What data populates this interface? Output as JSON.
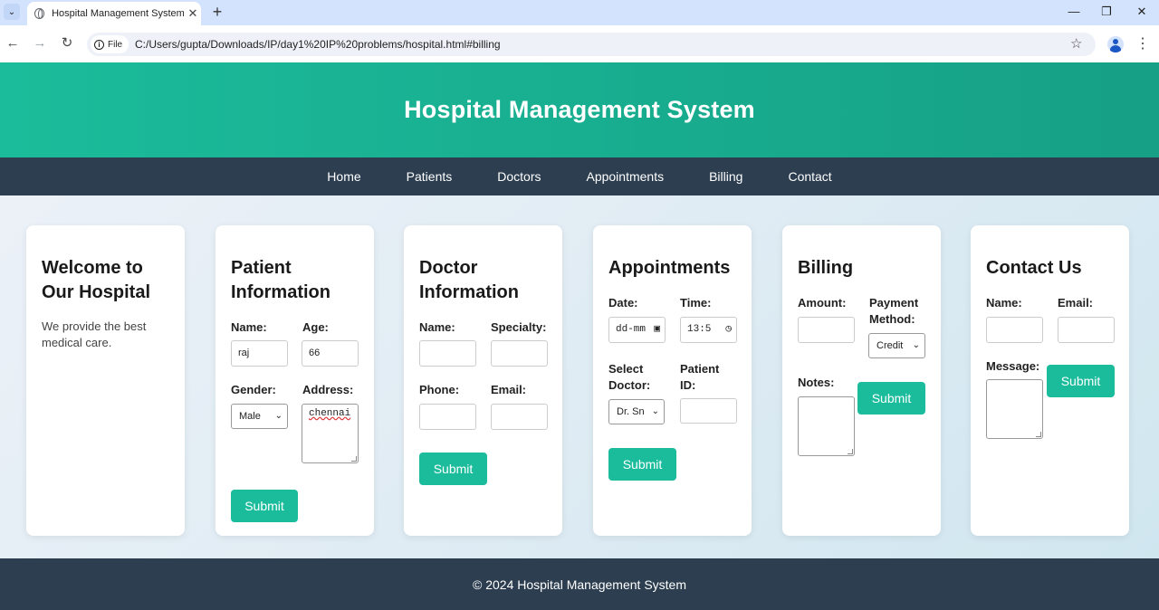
{
  "browser": {
    "tab_menu_icon": "chevron-down-icon",
    "tab_title": "Hospital Management System",
    "tab_close": "✕",
    "new_tab": "+",
    "minimize": "—",
    "restore": "❐",
    "close": "✕",
    "back": "←",
    "forward": "→",
    "reload": "↻",
    "chip_label": "File",
    "url": "C:/Users/gupta/Downloads/IP/day1%20IP%20problems/hospital.html#billing",
    "star": "☆",
    "menu": "⋮"
  },
  "header": {
    "title": "Hospital Management System"
  },
  "nav": {
    "items": [
      "Home",
      "Patients",
      "Doctors",
      "Appointments",
      "Billing",
      "Contact"
    ]
  },
  "welcome": {
    "title": "Welcome to Our Hospital",
    "text": "We provide the best medical care."
  },
  "patient": {
    "title": "Patient Information",
    "name_label": "Name:",
    "name_value": "raj",
    "age_label": "Age:",
    "age_value": "66",
    "gender_label": "Gender:",
    "gender_value": "Male",
    "address_label": "Address:",
    "address_value": "chennai",
    "submit": "Submit"
  },
  "doctor": {
    "title": "Doctor Information",
    "name_label": "Name:",
    "specialty_label": "Specialty:",
    "phone_label": "Phone:",
    "email_label": "Email:",
    "submit": "Submit"
  },
  "appointments": {
    "title": "Appointments",
    "date_label": "Date:",
    "date_value": "dd-mm",
    "time_label": "Time:",
    "time_value": "13:5",
    "doctor_label": "Select Doctor:",
    "doctor_value": "Dr. Sn",
    "patient_label": "Patient ID:",
    "submit": "Submit"
  },
  "billing": {
    "title": "Billing",
    "amount_label": "Amount:",
    "payment_label": "Payment Method:",
    "payment_value": "Credit",
    "notes_label": "Notes:",
    "submit": "Submit"
  },
  "contact": {
    "title": "Contact Us",
    "name_label": "Name:",
    "email_label": "Email:",
    "message_label": "Message:",
    "submit": "Submit"
  },
  "footer": {
    "text": "© 2024 Hospital Management System"
  },
  "colors": {
    "accent": "#1abc9c",
    "nav": "#2c3e50"
  }
}
